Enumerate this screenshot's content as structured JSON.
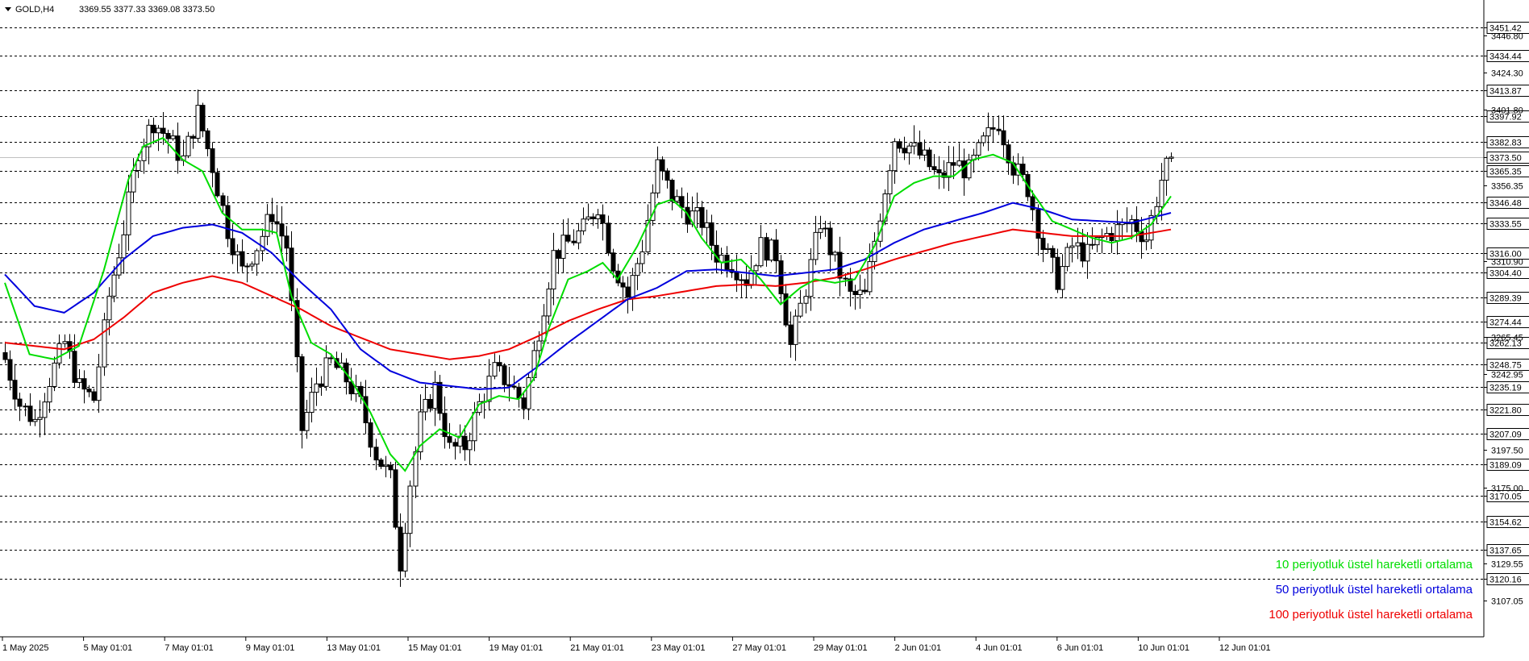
{
  "header": {
    "symbol": "GOLD,H4",
    "ohlc": "3369.55 3377.33 3369.08 3373.50"
  },
  "colors": {
    "background": "#ffffff",
    "candle_up": "#ffffff",
    "candle_down": "#000000",
    "ema10": "#00dd00",
    "ema50": "#0000dd",
    "ema100": "#ee0000",
    "grid": "#000000",
    "current_price_line": "#c0c0c0"
  },
  "chart_data": {
    "type": "candlestick",
    "symbol": "GOLD",
    "timeframe": "H4",
    "current_price": 3373.5,
    "ylim": [
      3100,
      3462
    ],
    "grid": "horizontal dashed lines at highlighted levels",
    "x_tick_labels": [
      "1 May 2025",
      "5 May 01:01",
      "7 May 01:01",
      "9 May 01:01",
      "13 May 01:01",
      "15 May 01:01",
      "19 May 01:01",
      "21 May 01:01",
      "23 May 01:01",
      "27 May 01:01",
      "29 May 01:01",
      "2 Jun 01:01",
      "4 Jun 01:01",
      "6 Jun 01:01",
      "10 Jun 01:01",
      "12 Jun 01:01"
    ],
    "y_boxed_levels": [
      "3451.42",
      "3434.44",
      "3413.87",
      "3397.92",
      "3382.83",
      "3373.50",
      "3365.35",
      "3346.48",
      "3333.55",
      "3316.00",
      "3304.40",
      "3289.39",
      "3274.44",
      "3262.13",
      "3248.75",
      "3235.19",
      "3221.80",
      "3207.09",
      "3189.09",
      "3170.05",
      "3154.62",
      "3137.65",
      "3120.16"
    ],
    "y_plain_ticks": [
      "3446.80",
      "3424.30",
      "3401.80",
      "3356.35",
      "3310.90",
      "3265.45",
      "3242.95",
      "3197.50",
      "3175.00",
      "3129.55",
      "3107.05"
    ],
    "legend": [
      {
        "label": "10 periyotluk üstel hareketli ortalama",
        "color": "#00dd00"
      },
      {
        "label": "50 periyotluk üstel hareketli ortalama",
        "color": "#0000dd"
      },
      {
        "label": "100 periyotluk üstel hareketli ortalama",
        "color": "#ee0000"
      }
    ],
    "legend_position": "bottom-right",
    "close_anchors": [
      [
        0,
        3252
      ],
      [
        3,
        3225
      ],
      [
        6,
        3215
      ],
      [
        9,
        3240
      ],
      [
        12,
        3262
      ],
      [
        15,
        3235
      ],
      [
        18,
        3228
      ],
      [
        21,
        3290
      ],
      [
        24,
        3330
      ],
      [
        27,
        3378
      ],
      [
        30,
        3395
      ],
      [
        33,
        3385
      ],
      [
        36,
        3372
      ],
      [
        39,
        3400
      ],
      [
        42,
        3368
      ],
      [
        45,
        3330
      ],
      [
        48,
        3305
      ],
      [
        51,
        3320
      ],
      [
        54,
        3340
      ],
      [
        57,
        3320
      ],
      [
        60,
        3210
      ],
      [
        63,
        3238
      ],
      [
        66,
        3250
      ],
      [
        69,
        3240
      ],
      [
        72,
        3225
      ],
      [
        75,
        3195
      ],
      [
        78,
        3180
      ],
      [
        80,
        3130
      ],
      [
        82,
        3178
      ],
      [
        84,
        3215
      ],
      [
        87,
        3235
      ],
      [
        90,
        3198
      ],
      [
        93,
        3200
      ],
      [
        96,
        3225
      ],
      [
        99,
        3245
      ],
      [
        102,
        3238
      ],
      [
        105,
        3225
      ],
      [
        108,
        3270
      ],
      [
        111,
        3315
      ],
      [
        114,
        3322
      ],
      [
        117,
        3330
      ],
      [
        120,
        3345
      ],
      [
        123,
        3310
      ],
      [
        126,
        3290
      ],
      [
        129,
        3320
      ],
      [
        132,
        3368
      ],
      [
        135,
        3350
      ],
      [
        138,
        3340
      ],
      [
        141,
        3335
      ],
      [
        144,
        3315
      ],
      [
        147,
        3310
      ],
      [
        150,
        3300
      ],
      [
        153,
        3320
      ],
      [
        156,
        3315
      ],
      [
        159,
        3260
      ],
      [
        162,
        3295
      ],
      [
        165,
        3335
      ],
      [
        168,
        3310
      ],
      [
        171,
        3290
      ],
      [
        174,
        3290
      ],
      [
        177,
        3340
      ],
      [
        180,
        3385
      ],
      [
        183,
        3380
      ],
      [
        186,
        3372
      ],
      [
        189,
        3360
      ],
      [
        192,
        3370
      ],
      [
        195,
        3365
      ],
      [
        198,
        3382
      ],
      [
        201,
        3395
      ],
      [
        204,
        3368
      ],
      [
        207,
        3355
      ],
      [
        210,
        3320
      ],
      [
        213,
        3300
      ],
      [
        216,
        3320
      ],
      [
        219,
        3315
      ],
      [
        222,
        3325
      ],
      [
        225,
        3330
      ],
      [
        228,
        3335
      ],
      [
        231,
        3325
      ],
      [
        234,
        3360
      ],
      [
        236,
        3373.5
      ]
    ],
    "ema10_anchors": [
      [
        0,
        3298
      ],
      [
        5,
        3255
      ],
      [
        10,
        3252
      ],
      [
        15,
        3260
      ],
      [
        20,
        3305
      ],
      [
        25,
        3360
      ],
      [
        28,
        3380
      ],
      [
        32,
        3385
      ],
      [
        36,
        3372
      ],
      [
        40,
        3365
      ],
      [
        44,
        3340
      ],
      [
        48,
        3330
      ],
      [
        52,
        3330
      ],
      [
        55,
        3328
      ],
      [
        58,
        3290
      ],
      [
        62,
        3262
      ],
      [
        66,
        3255
      ],
      [
        70,
        3240
      ],
      [
        74,
        3220
      ],
      [
        78,
        3195
      ],
      [
        81,
        3185
      ],
      [
        84,
        3200
      ],
      [
        88,
        3210
      ],
      [
        92,
        3205
      ],
      [
        96,
        3225
      ],
      [
        100,
        3230
      ],
      [
        104,
        3228
      ],
      [
        107,
        3240
      ],
      [
        110,
        3270
      ],
      [
        114,
        3300
      ],
      [
        118,
        3305
      ],
      [
        121,
        3310
      ],
      [
        124,
        3300
      ],
      [
        128,
        3320
      ],
      [
        132,
        3345
      ],
      [
        135,
        3348
      ],
      [
        138,
        3340
      ],
      [
        141,
        3325
      ],
      [
        145,
        3310
      ],
      [
        149,
        3312
      ],
      [
        153,
        3300
      ],
      [
        157,
        3285
      ],
      [
        161,
        3295
      ],
      [
        164,
        3300
      ],
      [
        168,
        3298
      ],
      [
        172,
        3300
      ],
      [
        176,
        3320
      ],
      [
        180,
        3350
      ],
      [
        184,
        3358
      ],
      [
        188,
        3362
      ],
      [
        192,
        3362
      ],
      [
        196,
        3372
      ],
      [
        200,
        3375
      ],
      [
        204,
        3370
      ],
      [
        208,
        3352
      ],
      [
        212,
        3335
      ],
      [
        216,
        3330
      ],
      [
        220,
        3325
      ],
      [
        224,
        3322
      ],
      [
        228,
        3325
      ],
      [
        232,
        3333
      ],
      [
        236,
        3350
      ]
    ],
    "ema50_anchors": [
      [
        0,
        3303
      ],
      [
        6,
        3284
      ],
      [
        12,
        3280
      ],
      [
        18,
        3292
      ],
      [
        24,
        3312
      ],
      [
        30,
        3326
      ],
      [
        36,
        3331
      ],
      [
        42,
        3333
      ],
      [
        48,
        3328
      ],
      [
        54,
        3316
      ],
      [
        60,
        3298
      ],
      [
        66,
        3282
      ],
      [
        72,
        3258
      ],
      [
        78,
        3245
      ],
      [
        84,
        3238
      ],
      [
        90,
        3236
      ],
      [
        96,
        3234
      ],
      [
        102,
        3235
      ],
      [
        108,
        3248
      ],
      [
        114,
        3262
      ],
      [
        120,
        3275
      ],
      [
        126,
        3288
      ],
      [
        132,
        3295
      ],
      [
        138,
        3305
      ],
      [
        144,
        3306
      ],
      [
        150,
        3304
      ],
      [
        156,
        3302
      ],
      [
        162,
        3304
      ],
      [
        168,
        3306
      ],
      [
        174,
        3312
      ],
      [
        180,
        3322
      ],
      [
        186,
        3330
      ],
      [
        192,
        3335
      ],
      [
        198,
        3340
      ],
      [
        204,
        3346
      ],
      [
        210,
        3342
      ],
      [
        216,
        3336
      ],
      [
        222,
        3335
      ],
      [
        228,
        3334
      ],
      [
        236,
        3340
      ]
    ],
    "ema100_anchors": [
      [
        0,
        3262
      ],
      [
        6,
        3260
      ],
      [
        12,
        3258
      ],
      [
        18,
        3264
      ],
      [
        24,
        3277
      ],
      [
        30,
        3292
      ],
      [
        36,
        3298
      ],
      [
        42,
        3302
      ],
      [
        48,
        3298
      ],
      [
        54,
        3290
      ],
      [
        60,
        3282
      ],
      [
        66,
        3272
      ],
      [
        72,
        3265
      ],
      [
        78,
        3258
      ],
      [
        84,
        3255
      ],
      [
        90,
        3252
      ],
      [
        96,
        3254
      ],
      [
        102,
        3258
      ],
      [
        108,
        3266
      ],
      [
        114,
        3275
      ],
      [
        120,
        3282
      ],
      [
        126,
        3288
      ],
      [
        132,
        3290
      ],
      [
        138,
        3293
      ],
      [
        144,
        3296
      ],
      [
        150,
        3297
      ],
      [
        156,
        3296
      ],
      [
        162,
        3298
      ],
      [
        168,
        3301
      ],
      [
        174,
        3306
      ],
      [
        180,
        3312
      ],
      [
        186,
        3317
      ],
      [
        192,
        3322
      ],
      [
        198,
        3326
      ],
      [
        204,
        3330
      ],
      [
        210,
        3328
      ],
      [
        216,
        3326
      ],
      [
        222,
        3326
      ],
      [
        228,
        3326
      ],
      [
        236,
        3330
      ]
    ],
    "candle_count": 237
  }
}
